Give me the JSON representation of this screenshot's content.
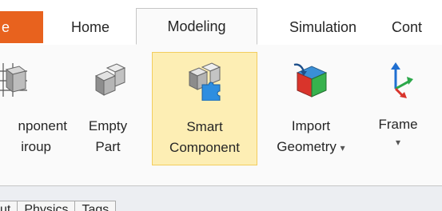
{
  "ribbon": {
    "tabs": {
      "file": "e",
      "home": "Home",
      "modeling": "Modeling",
      "simulation": "Simulation",
      "controller": "Cont"
    },
    "active_tab": "Modeling",
    "buttons": {
      "component_group": {
        "line1": "nponent",
        "line2": "iroup",
        "icon": "component-group-icon"
      },
      "empty_part": {
        "line1": "Empty",
        "line2": "Part",
        "icon": "empty-part-icon"
      },
      "smart_component": {
        "line1": "Smart",
        "line2": "Component",
        "icon": "smart-component-icon",
        "state": "hovered"
      },
      "import_geometry": {
        "line1": "Import",
        "line2": "Geometry",
        "dropdown_glyph": "▾",
        "icon": "import-geometry-icon"
      },
      "frame": {
        "line1": "Frame",
        "dropdown_glyph": "▾",
        "icon": "frame-icon"
      }
    }
  },
  "lower_panel": {
    "tabs": [
      "ut",
      "Physics",
      "Tags"
    ]
  },
  "colors": {
    "file_tab": "#e8621e",
    "hover_fill": "#fdeeb4",
    "hover_border": "#f3cd5e",
    "ribbon_bg": "#fafafa",
    "text": "#262626"
  }
}
